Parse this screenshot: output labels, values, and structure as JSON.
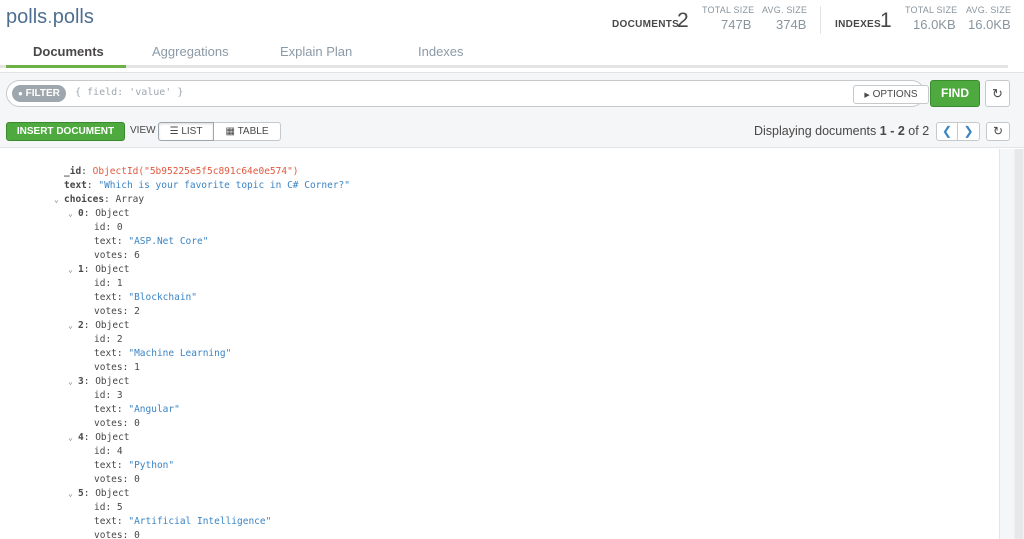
{
  "header": {
    "db": "polls",
    "dot": ".",
    "collection": "polls",
    "documents_label": "DOCUMENTS",
    "documents_count": "2",
    "docs_total_size_label": "TOTAL SIZE",
    "docs_total_size": "747B",
    "docs_avg_size_label": "AVG. SIZE",
    "docs_avg_size": "374B",
    "indexes_label": "INDEXES",
    "indexes_count": "1",
    "idx_total_size_label": "TOTAL SIZE",
    "idx_total_size": "16.0KB",
    "idx_avg_size_label": "AVG. SIZE",
    "idx_avg_size": "16.0KB"
  },
  "tabs": [
    {
      "label": "Documents"
    },
    {
      "label": "Aggregations"
    },
    {
      "label": "Explain Plan"
    },
    {
      "label": "Indexes"
    }
  ],
  "filter": {
    "chip": "FILTER",
    "placeholder": "{ field: 'value' }",
    "options_label": "OPTIONS",
    "find_label": "FIND"
  },
  "toolbar": {
    "insert_label": "INSERT DOCUMENT",
    "view_label": "VIEW",
    "list_label": "LIST",
    "table_label": "TABLE",
    "displaying_prefix": "Displaying documents",
    "range": "1 - 2",
    "of_label": "of",
    "total": "2"
  },
  "document": {
    "id_key": "_id",
    "id_value": "ObjectId(\"5b95225e5f5c891c64e0e574\")",
    "text_key": "text",
    "text_value": "\"Which is your favorite topic in C# Corner?\"",
    "choices_key": "choices",
    "choices_type": "Array",
    "choices": [
      {
        "index": "0",
        "type": "Object",
        "id": "0",
        "text": "\"ASP.Net Core\"",
        "votes": "6"
      },
      {
        "index": "1",
        "type": "Object",
        "id": "1",
        "text": "\"Blockchain\"",
        "votes": "2"
      },
      {
        "index": "2",
        "type": "Object",
        "id": "2",
        "text": "\"Machine Learning\"",
        "votes": "1"
      },
      {
        "index": "3",
        "type": "Object",
        "id": "3",
        "text": "\"Angular\"",
        "votes": "0"
      },
      {
        "index": "4",
        "type": "Object",
        "id": "4",
        "text": "\"Python\"",
        "votes": "0"
      },
      {
        "index": "5",
        "type": "Object",
        "id": "5",
        "text": "\"Artificial Intelligence\"",
        "votes": "0"
      }
    ],
    "labels": {
      "id": "id",
      "text": "text",
      "votes": "votes"
    }
  },
  "colors": {
    "accent_green": "#4eaa3f",
    "link_blue": "#3b84c4",
    "objectid_orange": "#e2583e"
  }
}
